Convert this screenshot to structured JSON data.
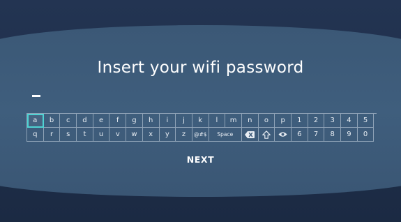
{
  "screen": {
    "title": "Insert your wifi password",
    "password_value": "",
    "next_label": "NEXT"
  },
  "keyboard": {
    "selected_key": "a",
    "row1": [
      "a",
      "b",
      "c",
      "d",
      "e",
      "f",
      "g",
      "h",
      "i",
      "j",
      "k",
      "l",
      "m",
      "n",
      "o",
      "p",
      "1",
      "2",
      "3",
      "4",
      "5"
    ],
    "row2_left": [
      "q",
      "r",
      "s",
      "t",
      "u",
      "v",
      "w",
      "x",
      "y",
      "z",
      "@#$"
    ],
    "space_label": "Space",
    "backspace_icon": "backspace-icon",
    "shift_icon": "shift-icon",
    "show_password_icon": "eye-icon",
    "row2_right": [
      "6",
      "7",
      "8",
      "9",
      "0"
    ]
  },
  "colors": {
    "background": "#1c2940",
    "panel": "#3d5a79",
    "selection": "#4fd3d3",
    "text": "#ffffff"
  }
}
